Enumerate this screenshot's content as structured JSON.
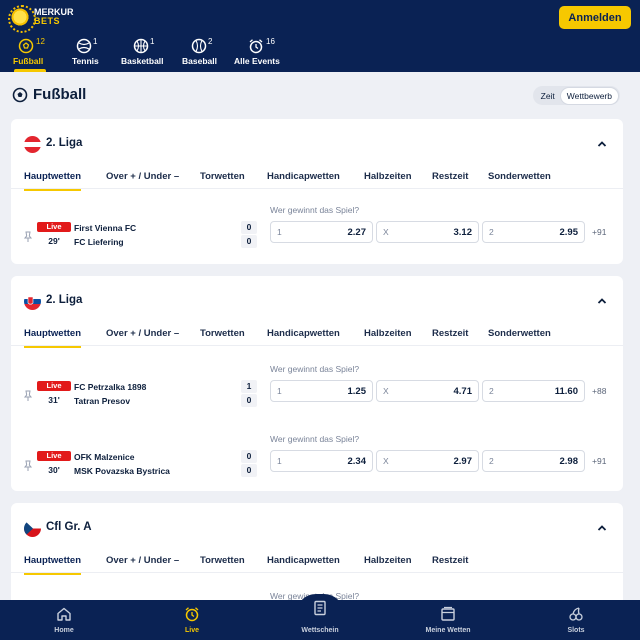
{
  "brand": {
    "line1": "MERKUR",
    "line2": "BETS"
  },
  "header": {
    "login_label": "Anmelden"
  },
  "sports": [
    {
      "label": "Fußball",
      "count": "12",
      "icon": "soccer-ball-icon",
      "active": true
    },
    {
      "label": "Tennis",
      "count": "1",
      "icon": "tennis-ball-icon"
    },
    {
      "label": "Basketball",
      "count": "1",
      "icon": "basketball-icon"
    },
    {
      "label": "Baseball",
      "count": "2",
      "icon": "baseball-icon"
    },
    {
      "label": "Alle Events",
      "count": "16",
      "icon": "alarm-clock-icon"
    }
  ],
  "page": {
    "title": "Fußball",
    "sort_options": [
      "Zeit",
      "Wettbewerb"
    ],
    "sort_selected": "Wettbewerb"
  },
  "market_tabs": [
    "Hauptwetten",
    "Over + / Under –",
    "Torwetten",
    "Handicapwetten",
    "Halbzeiten",
    "Restzeit",
    "Sonderwetten"
  ],
  "leagues": [
    {
      "name": "2. Liga",
      "flag": "austria-flag-icon",
      "matches": [
        {
          "live": "Live",
          "minute": "29'",
          "home": "First Vienna FC",
          "away": "FC Liefering",
          "score_home": "0",
          "score_away": "0",
          "question": "Wer gewinnt das Spiel?",
          "odds": [
            [
              "1",
              "2.27"
            ],
            [
              "X",
              "3.12"
            ],
            [
              "2",
              "2.95"
            ]
          ],
          "more": "+91"
        }
      ]
    },
    {
      "name": "2. Liga",
      "flag": "slovakia-flag-icon",
      "matches": [
        {
          "live": "Live",
          "minute": "31'",
          "home": "FC Petrzalka 1898",
          "away": "Tatran Presov",
          "score_home": "1",
          "score_away": "0",
          "question": "Wer gewinnt das Spiel?",
          "odds": [
            [
              "1",
              "1.25"
            ],
            [
              "X",
              "4.71"
            ],
            [
              "2",
              "11.60"
            ]
          ],
          "more": "+88"
        },
        {
          "live": "Live",
          "minute": "30'",
          "home": "OFK Malzenice",
          "away": "MSK Povazska Bystrica",
          "score_home": "0",
          "score_away": "0",
          "question": "Wer gewinnt das Spiel?",
          "odds": [
            [
              "1",
              "2.34"
            ],
            [
              "X",
              "2.97"
            ],
            [
              "2",
              "2.98"
            ]
          ],
          "more": "+91"
        }
      ]
    },
    {
      "name": "Cfl Gr. A",
      "flag": "czech-flag-icon",
      "tabs": [
        "Hauptwetten",
        "Over + / Under –",
        "Torwetten",
        "Handicapwetten",
        "Halbzeiten",
        "Restzeit"
      ],
      "matches": [
        {
          "question": "Wer gewinnt das Spiel?"
        }
      ]
    }
  ],
  "bottom_nav": [
    {
      "label": "Home",
      "icon": "home-icon"
    },
    {
      "label": "Live",
      "icon": "live-clock-icon",
      "active": true
    },
    {
      "label": "Wettschein",
      "icon": "bet-slip-icon"
    },
    {
      "label": "Meine Wetten",
      "icon": "my-bets-icon"
    },
    {
      "label": "Slots",
      "icon": "slots-icon"
    }
  ],
  "colors": {
    "navy": "#0a2254",
    "accent": "#f6c800",
    "live": "#e21a1a",
    "background": "#eef0f5"
  }
}
